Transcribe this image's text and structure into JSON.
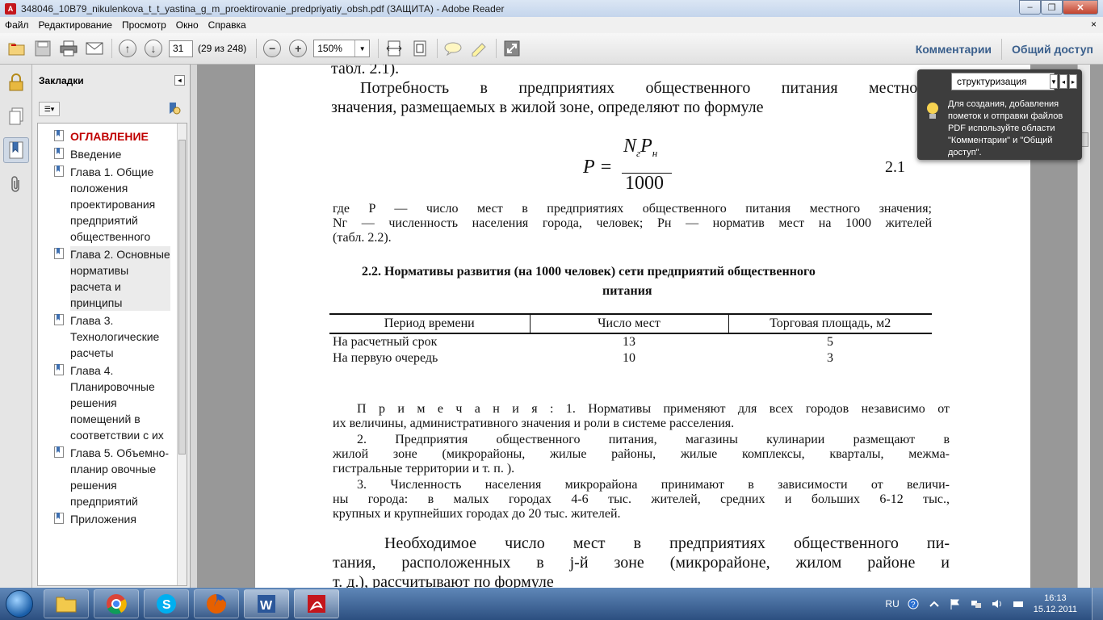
{
  "window": {
    "title": "348046_10B79_nikulenkova_t_t_yastina_g_m_proektirovanie_predpriyatiy_obsh.pdf (ЗАЩИТА) - Adobe Reader",
    "app_icon": "pdf-icon",
    "minimize": "–",
    "maximize": "❐",
    "close": "✕"
  },
  "menu": {
    "items": [
      "Файл",
      "Редактирование",
      "Просмотр",
      "Окно",
      "Справка"
    ],
    "close": "×"
  },
  "toolbar": {
    "page_number": "31",
    "page_count": "(29 из 248)",
    "zoom": "150%",
    "zoom_out": "−",
    "zoom_in": "+",
    "comments_label": "Комментарии",
    "share_label": "Общий доступ"
  },
  "bookmarks": {
    "title": "Закладки",
    "items": [
      "ОГЛАВЛЕНИЕ",
      "Введение",
      "Глава 1. Общие положения проектирования предприятий общественного",
      "Глава 2. Основные нормативы расчета и принципы",
      "Глава 3. Технологические расчеты",
      "Глава 4. Планировочные решения помещений в соответствии с их",
      "Глава 5. Объемно-планир овочные решения предприятий",
      "Приложения"
    ]
  },
  "popup": {
    "search_value": "структуризация",
    "hint": "Для создания, добавления пометок и отправки файлов PDF используйте области \"Комментарии\" и \"Общий доступ\"."
  },
  "document": {
    "line_top": "табл. 2.1).",
    "para1_line1": "Потребность в предприятиях общественного питания местного",
    "para1_line2": "значения, размещаемых в жилой зоне, определяют по формуле",
    "formula": {
      "lhs": "P =",
      "numerator_n": "N",
      "numerator_n_sub": "г",
      "numerator_p": "P",
      "numerator_p_sub": "н",
      "denominator": "1000",
      "number": "2.1"
    },
    "where_line1": "где P — число мест в предприятиях общественного питания местного значения;",
    "where_line2": "Nг — численность населения города, человек; Pн — норматив мест на 1000 жителей",
    "where_line3": "(табл. 2.2).",
    "table_title_line1": "2.2. Нормативы развития (на 1000 человек) сети предприятий общественного",
    "table_title_line2": "питания",
    "table": {
      "headers": [
        "Период времени",
        "Число мест",
        "Торговая площадь, м2"
      ],
      "rows": [
        [
          "На расчетный срок",
          "13",
          "5"
        ],
        [
          "На первую очередь",
          "10",
          "3"
        ]
      ]
    },
    "note1_line1": "П р и м е ч а н и я :  1. Нормативы применяют для всех городов независимо от",
    "note1_line2": "их величины, административного значения и роли в системе расселения.",
    "note2_line1": "2. Предприятия общественного питания, магазины кулинарии размещают в",
    "note2_line2": "жилой зоне (микрорайоны, жилые районы, жилые комплексы, кварталы, межма-",
    "note2_line3": "гистральные территории и т. п. ).",
    "note3_line1": "3. Численность населения микрорайона принимают в зависимости от величи-",
    "note3_line2": "ны города: в малых городах 4-6 тыс. жителей, средних и больших 6-12 тыс.,",
    "note3_line3": "крупных и крупнейших городах до 20 тыс. жителей.",
    "para2_line1": "Необходимое число мест в предприятиях общественного пи-",
    "para2_line2": "тания, расположенных в j-й зоне (микрорайоне, жилом районе и",
    "para2_line3": "т. д.), рассчитывают по формуле"
  },
  "taskbar": {
    "apps": [
      "explorer-icon",
      "chrome-icon",
      "skype-icon",
      "firefox-icon",
      "word-icon",
      "acrobat-icon"
    ],
    "lang": "RU",
    "time": "16:13",
    "date": "15.12.2011"
  },
  "colors": {
    "accent_link": "#3a5f8c",
    "bookmark_heading": "#c00000",
    "taskbar": "#2c4f80"
  }
}
